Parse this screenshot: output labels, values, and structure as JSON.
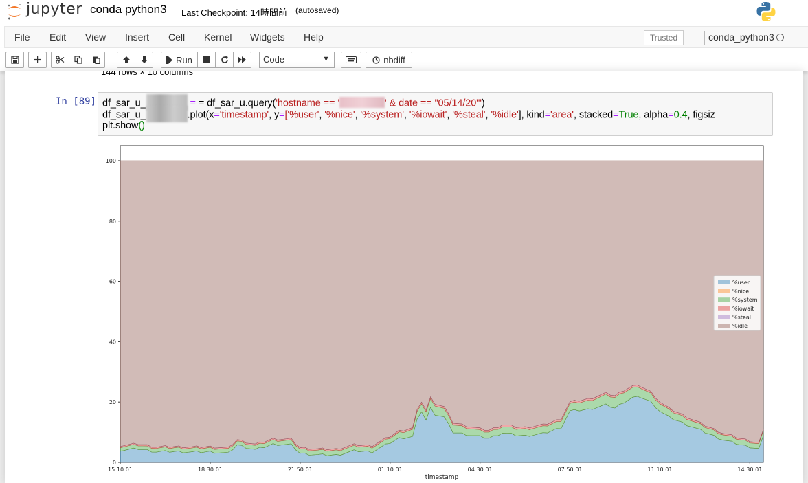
{
  "header": {
    "logo_text": "jupyter",
    "notebook_name": "conda python3",
    "checkpoint": "Last Checkpoint: 14時間前",
    "autosaved": "(autosaved)"
  },
  "menu": {
    "items": [
      "File",
      "Edit",
      "View",
      "Insert",
      "Cell",
      "Kernel",
      "Widgets",
      "Help"
    ],
    "trusted": "Trusted",
    "kernel": "conda_python3"
  },
  "toolbar": {
    "run_label": "Run",
    "cell_type": "Code",
    "nbdiff_label": "nbdiff"
  },
  "cell": {
    "prev_output": "144 rows × 10 columns",
    "prompt": "In [89]:",
    "line1": {
      "a": "df_sar_u_",
      "b": " = df_sar_u.query(",
      "c": "'hostname == '",
      "d": "' & date == \"05/14/20\"'",
      "e": ")"
    },
    "line2": {
      "a": "df_sar_u_",
      "b": ".plot(x",
      "c": "'timestamp'",
      "d": ", y",
      "e": "['%user'",
      "f": ", ",
      "g": "'%nice'",
      "h": "'%system'",
      "i": "'%iowait'",
      "j": "'%steal'",
      "k": "'%idle'",
      "l": "], kind",
      "m": "'area'",
      "n": ", stacked",
      "o": "True",
      "p": ", alpha",
      "q": "0.4",
      "r": ", figsiz"
    },
    "line3": {
      "a": "plt.show",
      "b": "()"
    }
  },
  "chart_data": {
    "type": "area",
    "stacked": true,
    "alpha": 0.4,
    "xlabel": "timestamp",
    "ylabel": "",
    "ylim": [
      0,
      105
    ],
    "yticks": [
      0,
      20,
      40,
      60,
      80,
      100
    ],
    "xtick_labels": [
      "15:10:01",
      "18:30:01",
      "21:50:01",
      "01:10:01",
      "04:30:01",
      "07:50:01",
      "11:10:01",
      "14:30:01"
    ],
    "xtick_indices": [
      0,
      20,
      40,
      60,
      80,
      100,
      120,
      140
    ],
    "n_points": 144,
    "legend_loc": "center right",
    "grid": false,
    "series": [
      {
        "name": "%user",
        "color": "#1f77b4"
      },
      {
        "name": "%nice",
        "color": "#ff7f0e"
      },
      {
        "name": "%system",
        "color": "#2ca02c"
      },
      {
        "name": "%iowait",
        "color": "#d62728"
      },
      {
        "name": "%steal",
        "color": "#9467bd"
      },
      {
        "name": "%idle",
        "color": "#8c564b"
      }
    ],
    "user_keypoints": [
      [
        0,
        4
      ],
      [
        4,
        4.5
      ],
      [
        8,
        3.5
      ],
      [
        12,
        3.6
      ],
      [
        16,
        3.4
      ],
      [
        20,
        3.5
      ],
      [
        24,
        3
      ],
      [
        26,
        5.8
      ],
      [
        30,
        4.2
      ],
      [
        34,
        6
      ],
      [
        38,
        5.8
      ],
      [
        40,
        3
      ],
      [
        44,
        2.5
      ],
      [
        48,
        2.4
      ],
      [
        52,
        3.8
      ],
      [
        56,
        3.5
      ],
      [
        58,
        5
      ],
      [
        62,
        8
      ],
      [
        65,
        8.5
      ],
      [
        66,
        14
      ],
      [
        67,
        17
      ],
      [
        68,
        14
      ],
      [
        69,
        18
      ],
      [
        70,
        16
      ],
      [
        72,
        15
      ],
      [
        74,
        10
      ],
      [
        76,
        9.5
      ],
      [
        78,
        9
      ],
      [
        80,
        8.5
      ],
      [
        82,
        8
      ],
      [
        85,
        9.8
      ],
      [
        88,
        9
      ],
      [
        90,
        8.8
      ],
      [
        94,
        9.5
      ],
      [
        98,
        11.5
      ],
      [
        100,
        17
      ],
      [
        104,
        17.5
      ],
      [
        108,
        19
      ],
      [
        110,
        18
      ],
      [
        112,
        20
      ],
      [
        114,
        21.5
      ],
      [
        116,
        21.5
      ],
      [
        118,
        20
      ],
      [
        120,
        17
      ],
      [
        122,
        15
      ],
      [
        126,
        12.5
      ],
      [
        130,
        10
      ],
      [
        134,
        7.5
      ],
      [
        138,
        5.8
      ],
      [
        142,
        4.5
      ],
      [
        143,
        8.5
      ]
    ],
    "system_keypoints": [
      [
        0,
        1.2
      ],
      [
        26,
        1.3
      ],
      [
        60,
        1.6
      ],
      [
        66,
        2.5
      ],
      [
        70,
        3
      ],
      [
        80,
        2
      ],
      [
        100,
        2.4
      ],
      [
        110,
        3.5
      ],
      [
        114,
        3.3
      ],
      [
        120,
        2.5
      ],
      [
        130,
        1.8
      ],
      [
        143,
        1.6
      ]
    ],
    "iowait_keypoints": [
      [
        0,
        0.4
      ],
      [
        60,
        0.5
      ],
      [
        70,
        0.6
      ],
      [
        110,
        0.6
      ],
      [
        143,
        0.4
      ]
    ],
    "nice_value": 0,
    "steal_value": 0,
    "idle": "remainder to 100"
  }
}
